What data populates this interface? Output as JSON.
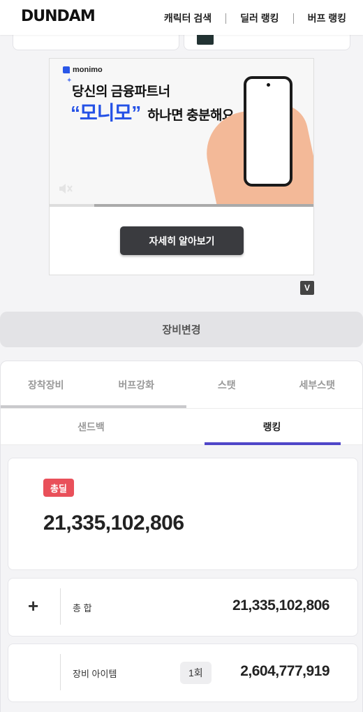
{
  "header": {
    "logo": "DUNDAM",
    "nav": [
      {
        "label": "캐릭터 검색"
      },
      {
        "label": "딜러 랭킹"
      },
      {
        "label": "버프 랭킹"
      }
    ]
  },
  "ad": {
    "brand": "monimo",
    "line1": "당신의 금융파트너",
    "line2_big": "“모니모”",
    "line2_rest": "하나면 충분해요",
    "cta": "자세히 알아보기",
    "badge": "V",
    "progress": 0.17
  },
  "equip_change": "장비변경",
  "tabs": [
    {
      "label": "장착장비"
    },
    {
      "label": "버프강화"
    },
    {
      "label": "스탯"
    },
    {
      "label": "세부스탯"
    }
  ],
  "subtabs": [
    {
      "label": "샌드백"
    },
    {
      "label": "랭킹"
    }
  ],
  "total": {
    "badge": "총딜",
    "value": "21,335,102,806"
  },
  "rows": [
    {
      "icon": "+",
      "label": "총 합",
      "value": "21,335,102,806"
    },
    {
      "label": "장비 아이템",
      "count": "1회",
      "value": "2,604,777,919"
    }
  ],
  "colors": {
    "accent": "#4f46c8",
    "badge_red": "#e9505a",
    "ad_blue": "#2451e6"
  }
}
